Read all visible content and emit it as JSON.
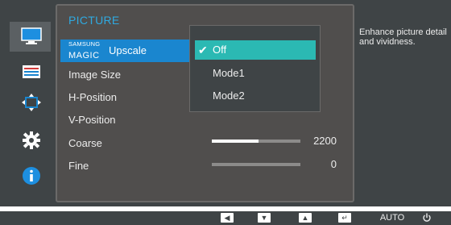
{
  "menu": {
    "title": "PICTURE",
    "selected": {
      "brand_small": "SAMSUNG",
      "brand_big": "MAGIC",
      "label": "Upscale"
    },
    "items": [
      {
        "label": "Image Size"
      },
      {
        "label": "H-Position"
      },
      {
        "label": "V-Position"
      },
      {
        "label": "Coarse",
        "value": "2200",
        "level": 0.53
      },
      {
        "label": "Fine",
        "value": "0",
        "level": 0.0
      }
    ]
  },
  "submenu": {
    "options": [
      {
        "label": "Off",
        "active": true
      },
      {
        "label": "Mode1",
        "active": false
      },
      {
        "label": "Mode2",
        "active": false
      }
    ]
  },
  "description": "Enhance picture detail and vividness.",
  "sidebar_icons": [
    "monitor-icon",
    "onscreen-display-icon",
    "position-icon",
    "settings-gear-icon",
    "info-icon"
  ],
  "bottom_bar": {
    "auto_label": "AUTO",
    "buttons": [
      "left-arrow-icon",
      "down-arrow-icon",
      "up-arrow-icon",
      "enter-icon",
      "power-icon"
    ]
  },
  "colors": {
    "accent": "#2fa9e0",
    "selection": "#1a86cf",
    "active_option": "#2bb9b3",
    "background": "#3f4446"
  }
}
